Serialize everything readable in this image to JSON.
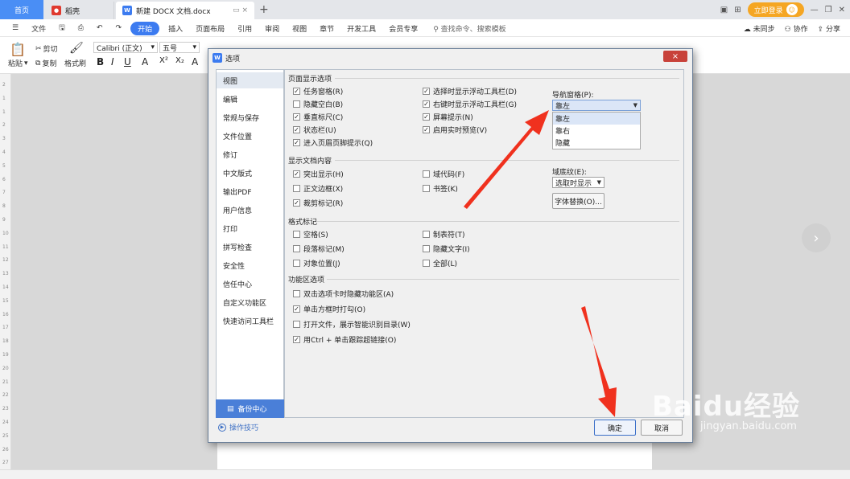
{
  "titlebar": {
    "home_tab": "首页",
    "tabs": [
      {
        "label": "稻壳",
        "icon": "daoke-icon",
        "color": "#e03a2f"
      },
      {
        "label": "新建 DOCX 文档.docx",
        "icon": "wps-doc-icon",
        "color": "#3c7bf0"
      }
    ],
    "new_tab": "+",
    "login_label": "立即登录"
  },
  "menubar": {
    "items": [
      "文件",
      "开始",
      "插入",
      "页面布局",
      "引用",
      "审阅",
      "视图",
      "章节",
      "开发工具",
      "会员专享"
    ],
    "active": "开始",
    "search_placeholder": "查找命令、搜索模板",
    "right": [
      "未同步",
      "协作",
      "分享"
    ]
  },
  "toolbar": {
    "paste": "粘贴",
    "cut": "剪切",
    "copy": "复制",
    "format_painter": "格式刷",
    "font": "Calibri (正文)",
    "size": "五号",
    "format_buttons": [
      "B",
      "I",
      "U",
      "A",
      "X²",
      "X₂",
      "A"
    ]
  },
  "dialog": {
    "title": "选项",
    "close": "×",
    "sidebar": [
      "视图",
      "编辑",
      "常规与保存",
      "文件位置",
      "修订",
      "中文版式",
      "输出PDF",
      "用户信息",
      "打印",
      "拼写检查",
      "安全性",
      "信任中心",
      "自定义功能区",
      "快速访问工具栏"
    ],
    "selected": "视图",
    "backup": "备份中心",
    "tips": "操作技巧",
    "sections": {
      "page_display": {
        "title": "页面显示选项",
        "col1": [
          {
            "label": "任务窗格(R)",
            "checked": true
          },
          {
            "label": "隐藏空白(B)",
            "checked": false
          },
          {
            "label": "垂直标尺(C)",
            "checked": true
          },
          {
            "label": "状态栏(U)",
            "checked": true
          },
          {
            "label": "进入页眉页脚提示(Q)",
            "checked": true
          }
        ],
        "col2": [
          {
            "label": "选择时显示浮动工具栏(D)",
            "checked": true
          },
          {
            "label": "右键时显示浮动工具栏(G)",
            "checked": true
          },
          {
            "label": "屏幕提示(N)",
            "checked": true
          },
          {
            "label": "启用实时预览(V)",
            "checked": true
          }
        ],
        "nav_label": "导航窗格(P):",
        "nav_value": "靠左",
        "nav_options": [
          "靠左",
          "靠右",
          "隐藏"
        ]
      },
      "doc_content": {
        "title": "显示文档内容",
        "col1": [
          {
            "label": "突出显示(H)",
            "checked": true
          },
          {
            "label": "正文边框(X)",
            "checked": false
          },
          {
            "label": "裁剪标记(R)",
            "checked": true
          }
        ],
        "col2": [
          {
            "label": "域代码(F)",
            "checked": false
          },
          {
            "label": "书签(K)",
            "checked": false
          }
        ],
        "field_label": "域底纹(E):",
        "field_value": "选取时显示",
        "font_replace": "字体替换(O)..."
      },
      "format_marks": {
        "title": "格式标记",
        "col1": [
          {
            "label": "空格(S)",
            "checked": false
          },
          {
            "label": "段落标记(M)",
            "checked": false
          },
          {
            "label": "对象位置(J)",
            "checked": false
          }
        ],
        "col2": [
          {
            "label": "制表符(T)",
            "checked": false
          },
          {
            "label": "隐藏文字(I)",
            "checked": false
          },
          {
            "label": "全部(L)",
            "checked": false
          }
        ]
      },
      "ribbon": {
        "title": "功能区选项",
        "items": [
          {
            "label": "双击选项卡时隐藏功能区(A)",
            "checked": false
          },
          {
            "label": "单击方框时打勾(O)",
            "checked": true
          },
          {
            "label": "打开文件，展示智能识别目录(W)",
            "checked": false
          },
          {
            "label": "用Ctrl + 单击跟踪超链接(O)",
            "checked": true
          }
        ]
      }
    },
    "ok": "确定",
    "cancel": "取消"
  },
  "overlay": {
    "arrow_color": "#f0311e",
    "watermark_main": "Baidu经验",
    "watermark_sub": "jingyan.baidu.com"
  },
  "ruler_numbers": [
    "2",
    "1",
    "1",
    "2",
    "3",
    "4",
    "5",
    "6",
    "7",
    "8",
    "9",
    "10",
    "11",
    "12",
    "13",
    "14",
    "15",
    "16",
    "17",
    "18",
    "19",
    "20",
    "21",
    "22",
    "23",
    "24",
    "25",
    "26",
    "27"
  ]
}
